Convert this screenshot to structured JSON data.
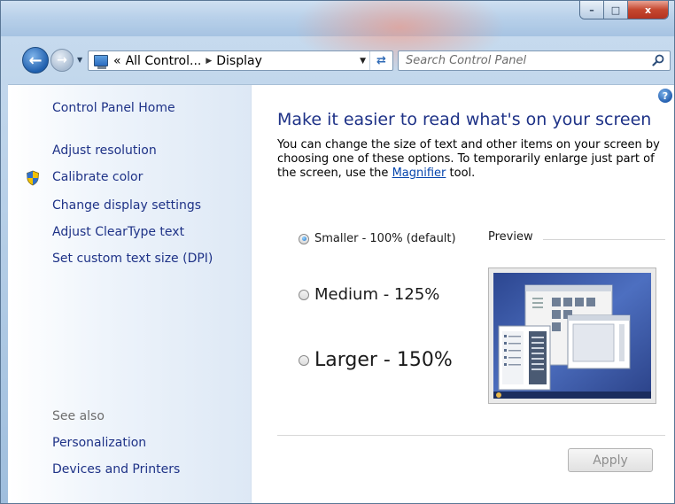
{
  "window": {
    "caption_buttons": {
      "minimize_glyph": "–",
      "maximize_glyph": "□",
      "close_glyph": "x"
    }
  },
  "navbar": {
    "back_glyph": "←",
    "forward_glyph": "→",
    "address": {
      "prefix": "«",
      "crumb1": "All Control...",
      "crumb2": "Display"
    },
    "search": {
      "placeholder": "Search Control Panel"
    }
  },
  "sidebar": {
    "home": "Control Panel Home",
    "links": [
      "Adjust resolution",
      "Calibrate color",
      "Change display settings",
      "Adjust ClearType text",
      "Set custom text size (DPI)"
    ],
    "see_also_heading": "See also",
    "see_also": [
      "Personalization",
      "Devices and Printers"
    ]
  },
  "main": {
    "help_glyph": "?",
    "heading": "Make it easier to read what's on your screen",
    "description_part1": "You can change the size of text and other items on your screen by choosing one of these options. To temporarily enlarge just part of the screen, use the ",
    "description_link": "Magnifier",
    "description_part2": " tool.",
    "options": [
      {
        "label": "Smaller - 100% (default)",
        "checked": true
      },
      {
        "label": "Medium - 125%",
        "checked": false
      },
      {
        "label": "Larger - 150%",
        "checked": false
      }
    ],
    "preview_label": "Preview",
    "apply_label": "Apply"
  },
  "colors": {
    "link": "#1e3287",
    "heading": "#1e3287",
    "preview_desktop": "#3d5aa8"
  }
}
